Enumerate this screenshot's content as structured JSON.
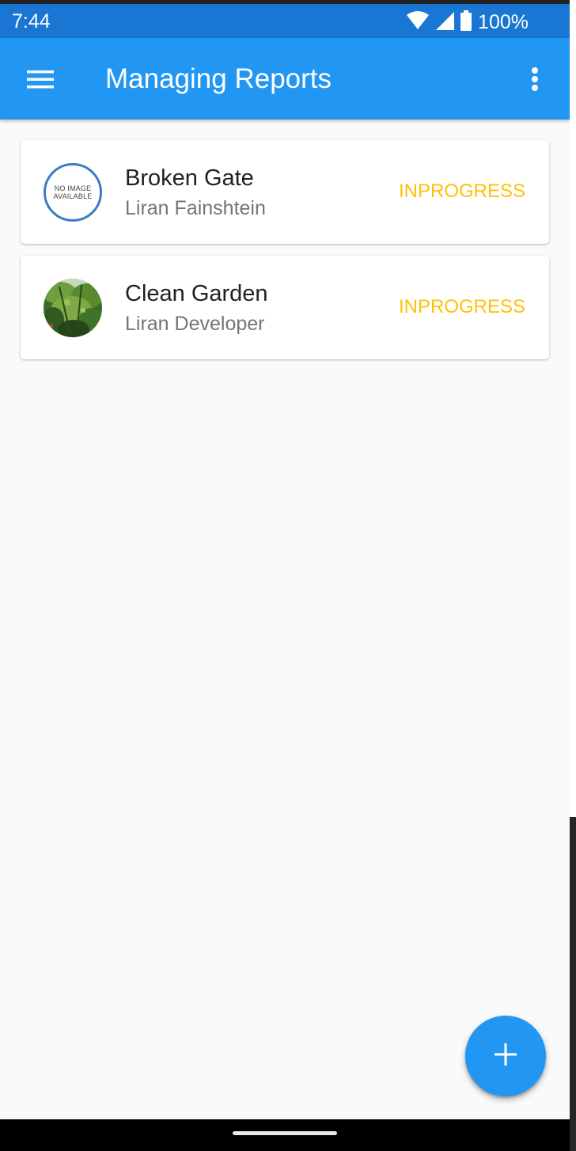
{
  "status_bar": {
    "time": "7:44",
    "battery_text": "100%",
    "icons": [
      "wifi-icon",
      "signal-icon",
      "battery-icon"
    ]
  },
  "app_bar": {
    "title": "Managing Reports",
    "menu_icon": "hamburger-menu-icon",
    "overflow_icon": "more-vert-icon"
  },
  "reports": [
    {
      "title": "Broken Gate",
      "author": "Liran Fainshtein",
      "status": "INPROGRESS",
      "image": "no-image-placeholder",
      "image_text_line1": "NO IMAGE",
      "image_text_line2": "AVAILABLE"
    },
    {
      "title": "Clean Garden",
      "author": "Liran Developer",
      "status": "INPROGRESS",
      "image": "garden-photo"
    }
  ],
  "fab": {
    "icon": "add-icon"
  },
  "colors": {
    "primary": "#2196f3",
    "primary_dark": "#1976d2",
    "status_inprogress": "#ffc107",
    "background": "#fafafa"
  }
}
